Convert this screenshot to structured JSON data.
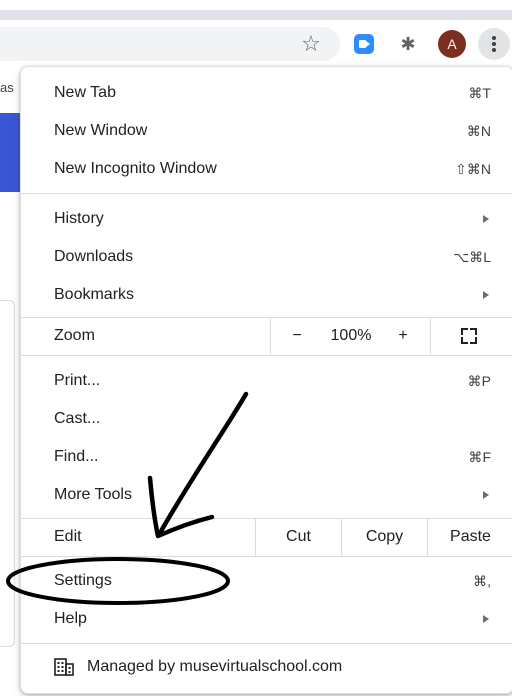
{
  "browser": {
    "avatar_initial": "A",
    "behind_text": "as",
    "icons": [
      "star-icon",
      "zoom-extension-icon",
      "puzzle-icon",
      "avatar",
      "kebab-menu-icon"
    ]
  },
  "menu": {
    "group1": [
      {
        "label": "New Tab",
        "shortcut": "⌘T"
      },
      {
        "label": "New Window",
        "shortcut": "⌘N"
      },
      {
        "label": "New Incognito Window",
        "shortcut": "⇧⌘N"
      }
    ],
    "group2": [
      {
        "label": "History",
        "shortcut": ""
      },
      {
        "label": "Downloads",
        "shortcut": "⌥⌘L"
      },
      {
        "label": "Bookmarks",
        "shortcut": ""
      }
    ],
    "zoom": {
      "label": "Zoom",
      "minus": "−",
      "value": "100%",
      "plus": "+"
    },
    "group3": [
      {
        "label": "Print...",
        "shortcut": "⌘P"
      },
      {
        "label": "Cast...",
        "shortcut": ""
      },
      {
        "label": "Find...",
        "shortcut": "⌘F"
      },
      {
        "label": "More Tools",
        "shortcut": ""
      }
    ],
    "edit": {
      "label": "Edit",
      "cut": "Cut",
      "copy": "Copy",
      "paste": "Paste"
    },
    "group4": [
      {
        "label": "Settings",
        "shortcut": "⌘,"
      },
      {
        "label": "Help",
        "shortcut": ""
      }
    ],
    "managed": {
      "text": "Managed by musevirtualschool.com"
    }
  },
  "colors": {
    "annotation": "#000000",
    "menu_bg": "#ffffff",
    "separator": "#dadce0"
  }
}
